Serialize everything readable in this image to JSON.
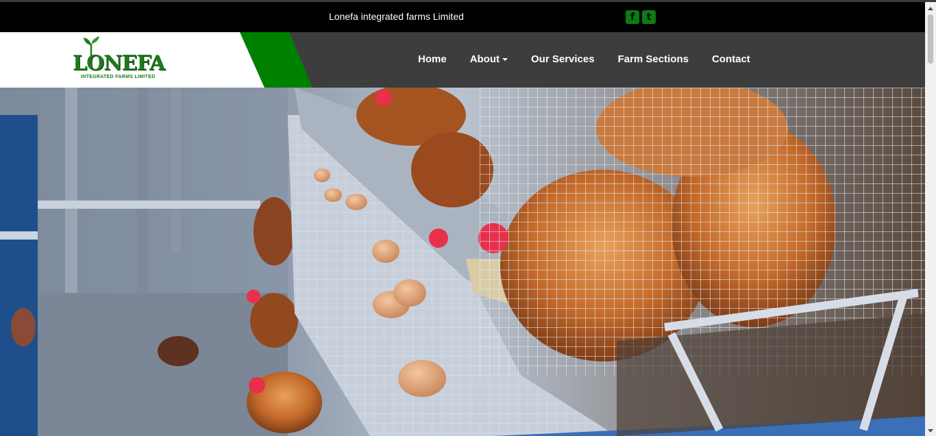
{
  "topbar": {
    "tagline": "Lonefa integrated farms Limited",
    "social": [
      {
        "icon": "facebook-square-icon",
        "glyph": "f"
      },
      {
        "icon": "twitter-square-icon",
        "glyph": "t"
      }
    ],
    "social_color": "#0a7d12"
  },
  "logo": {
    "name": "LONEFA",
    "subtitle": "INTEGRATED FARMS LIMITED",
    "brand_color": "#1d7a1d",
    "accent_color": "#008000"
  },
  "nav": {
    "items": [
      {
        "label": "Home"
      },
      {
        "label": "About"
      },
      {
        "label": "Our Services"
      },
      {
        "label": "Farm Sections"
      },
      {
        "label": "Contact"
      }
    ],
    "background": "#3d3d3d"
  }
}
